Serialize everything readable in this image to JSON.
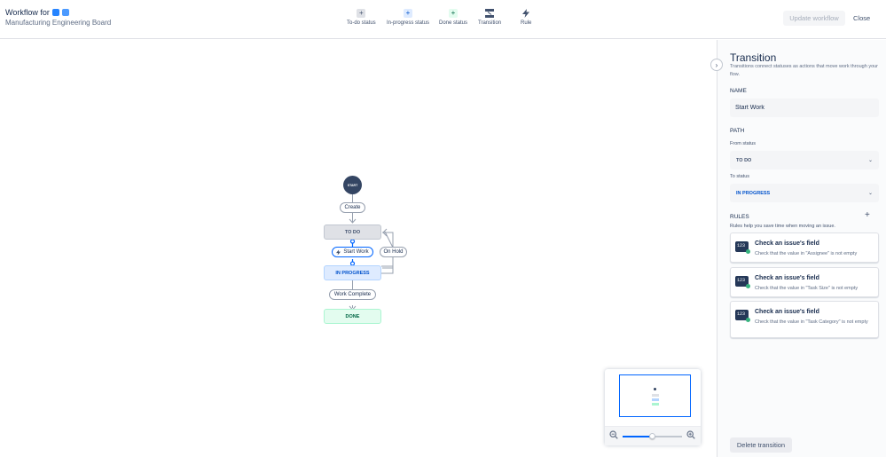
{
  "header": {
    "title_prefix": "Workflow for",
    "subtitle": "Manufacturing Engineering Board",
    "update_label": "Update workflow",
    "close_label": "Close"
  },
  "toolbar": {
    "items": [
      {
        "label": "To-do status",
        "icon": "plus-icon"
      },
      {
        "label": "In-progress status",
        "icon": "plus-icon"
      },
      {
        "label": "Done status",
        "icon": "plus-icon"
      },
      {
        "label": "Transition",
        "icon": "transition-icon"
      },
      {
        "label": "Rule",
        "icon": "lightning-icon"
      }
    ]
  },
  "diagram": {
    "start_label": "START",
    "create_label": "Create",
    "todo_label": "TO DO",
    "start_work_label": "Start Work",
    "on_hold_label": "On Hold",
    "in_progress_label": "IN PROGRESS",
    "work_complete_label": "Work Complete",
    "done_label": "DONE"
  },
  "zoom": {
    "level": 0.5
  },
  "panel": {
    "title": "Transition",
    "description": "Transitions connect statuses as actions that move work through your flow.",
    "name_label": "NAME",
    "name_value": "Start Work",
    "path_label": "PATH",
    "from_label": "From status",
    "from_value": "TO DO",
    "to_label": "To status",
    "to_value": "IN PROGRESS",
    "rules_label": "RULES",
    "rules_help": "Rules help you save time when moving an issue.",
    "rules": [
      {
        "name": "Check an issue's field",
        "description": "Check that the value in \"Assignee\" is not empty"
      },
      {
        "name": "Check an issue's field",
        "description": "Check that the value in \"Task Size\" is not empty"
      },
      {
        "name": "Check an issue's field",
        "description": "Check that the value in \"Task Category\" is not empty"
      }
    ],
    "rule_icon_text": "123",
    "delete_label": "Delete transition"
  },
  "colors": {
    "accent": "#0065ff",
    "todo": "#dfe1e6",
    "in_progress": "#deebff",
    "done": "#e3fcef",
    "start": "#344563"
  }
}
